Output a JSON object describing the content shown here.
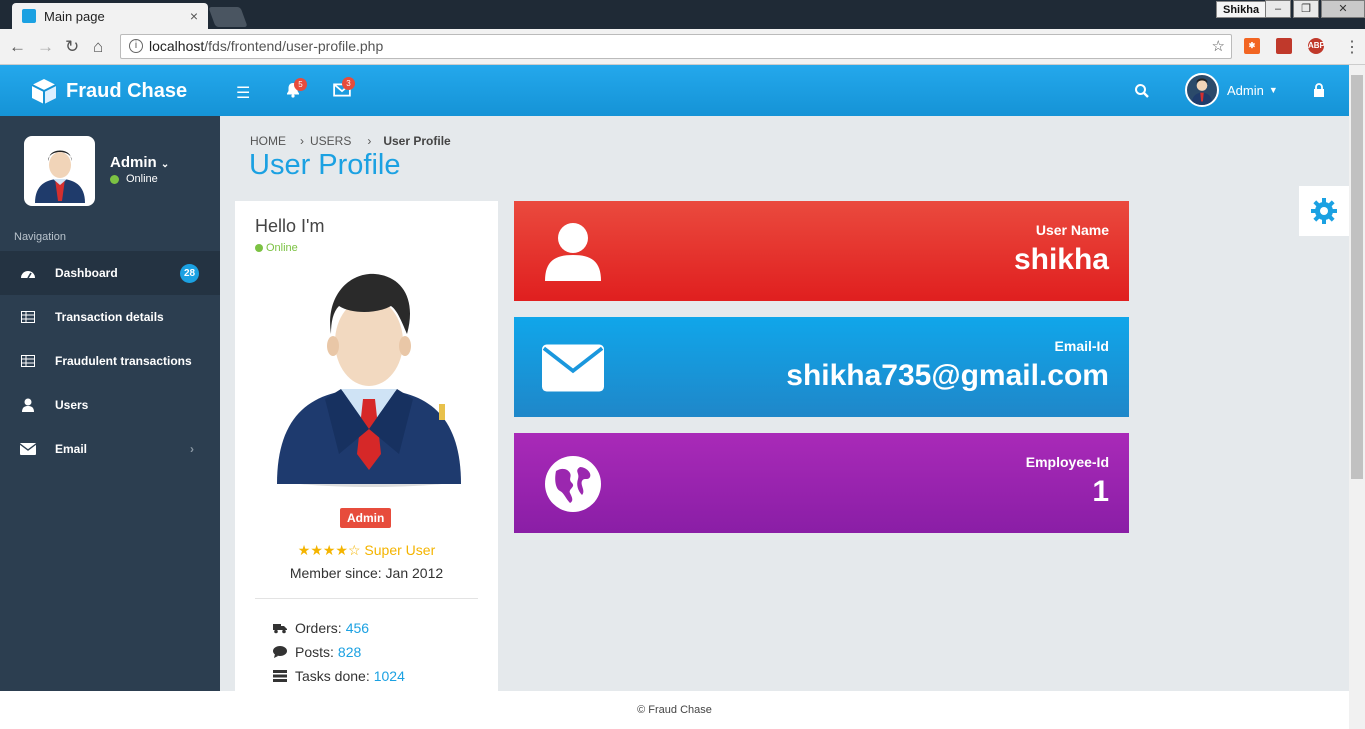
{
  "browser": {
    "tab_title": "Main page",
    "tab_close": "×",
    "profile_name": "Shikha",
    "url_host": "localhost",
    "url_path": "/fds/frontend/user-profile.php",
    "ext_abp": "ABP"
  },
  "header": {
    "brand": "Fraud Chase",
    "notifications_count": "5",
    "messages_count": "3",
    "user_name": "Admin",
    "colors": {
      "bar": "#1ba1e2"
    }
  },
  "sidebar": {
    "user_name": "Admin",
    "user_status": "Online",
    "section_label": "Navigation",
    "items": [
      {
        "label": "Dashboard",
        "icon": "dashboard-icon",
        "badge": "28"
      },
      {
        "label": "Transaction details",
        "icon": "table-icon"
      },
      {
        "label": "Fraudulent transactions",
        "icon": "table-icon"
      },
      {
        "label": "Users",
        "icon": "user-icon"
      },
      {
        "label": "Email",
        "icon": "envelope-icon"
      }
    ]
  },
  "breadcrumb": {
    "home": "HOME",
    "users": "USERS",
    "current": "User Profile"
  },
  "page_title": "User Profile",
  "profile_card": {
    "greeting": "Hello I'm",
    "status": "Online",
    "role": "Admin",
    "rating_stars": "★★★★☆",
    "rating_label": "Super User",
    "member_since": "Member since: Jan 2012",
    "stats": [
      {
        "label": "Orders:",
        "value": "456",
        "icon": "truck-icon"
      },
      {
        "label": "Posts:",
        "value": "828",
        "icon": "comment-icon"
      },
      {
        "label": "Tasks done:",
        "value": "1024",
        "icon": "tasks-icon"
      }
    ]
  },
  "info_cards": [
    {
      "label": "User Name",
      "value": "shikha",
      "icon": "user-icon",
      "color": "#e8322a"
    },
    {
      "label": "Email-Id",
      "value": "shikha735@gmail.com",
      "icon": "envelope-icon",
      "color": "#1a9fe3"
    },
    {
      "label": "Employee-Id",
      "value": "1",
      "icon": "globe-icon",
      "color": "#9b27af"
    }
  ],
  "footer": "© Fraud Chase"
}
